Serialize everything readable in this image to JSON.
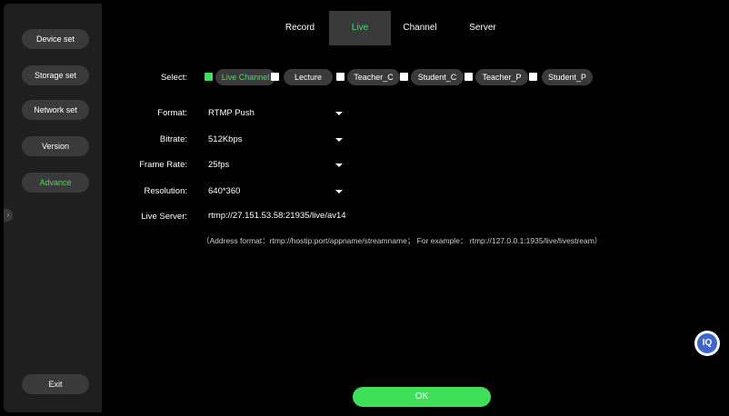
{
  "sidebar": {
    "items": [
      {
        "label": "Device set"
      },
      {
        "label": "Storage set"
      },
      {
        "label": "Network set"
      },
      {
        "label": "Version"
      },
      {
        "label": "Advance"
      }
    ],
    "exit_label": "Exit",
    "collapse_icon": "chevron-right-icon"
  },
  "tabs": [
    {
      "label": "Record"
    },
    {
      "label": "Live"
    },
    {
      "label": "Channel"
    },
    {
      "label": "Server"
    }
  ],
  "form": {
    "select_label": "Select:",
    "options": [
      {
        "label": "Live Channel",
        "checked": true
      },
      {
        "label": "Lecture",
        "checked": false
      },
      {
        "label": "Teacher_C",
        "checked": false
      },
      {
        "label": "Student_C",
        "checked": false
      },
      {
        "label": "Teacher_P",
        "checked": false
      },
      {
        "label": "Student_P",
        "checked": false
      }
    ],
    "format": {
      "label": "Format:",
      "value": "RTMP Push"
    },
    "bitrate": {
      "label": "Bitrate:",
      "value": "512Kbps"
    },
    "frame_rate": {
      "label": "Frame Rate:",
      "value": "25fps"
    },
    "resolution": {
      "label": "Resolution:",
      "value": "640*360"
    },
    "live_server": {
      "label": "Live Server:",
      "value": "rtmp://27.151.53.58:21935/live/av14"
    },
    "hint": "（Address format：rtmp://hostip:port/appname/streamname； For example： rtmp://127.0.0.1:1935/live/livestream）"
  },
  "ok_label": "OK",
  "help_label": "IQ",
  "colors": {
    "accent": "#3ee05a",
    "panel": "#1f1f1f",
    "button": "#3a3a3a",
    "help": "#3d67c8"
  }
}
